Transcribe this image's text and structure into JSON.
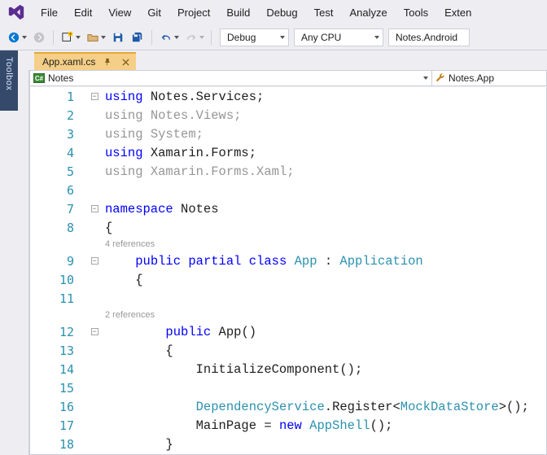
{
  "menu": [
    "File",
    "Edit",
    "View",
    "Git",
    "Project",
    "Build",
    "Debug",
    "Test",
    "Analyze",
    "Tools",
    "Exten"
  ],
  "toolbar": {
    "config": "Debug",
    "platform": "Any CPU",
    "target": "Notes.Android"
  },
  "tab": {
    "title": "App.xaml.cs"
  },
  "navbar": {
    "left_badge": "C#",
    "left": "Notes",
    "right": "Notes.App"
  },
  "toolbox_label": "Toolbox",
  "codelens": {
    "class": "4 references",
    "ctor": "2 references"
  },
  "code": {
    "l1": {
      "a": "using",
      "b": " Notes.Services;"
    },
    "l2": {
      "a": "using",
      "b": " Notes.Views;"
    },
    "l3": {
      "a": "using",
      "b": " System;"
    },
    "l4": {
      "a": "using",
      "b": " Xamarin.Forms;"
    },
    "l5": {
      "a": "using",
      "b": " Xamarin.Forms.Xaml;"
    },
    "l7": {
      "a": "namespace",
      "b": " Notes"
    },
    "l8": "{",
    "l9": {
      "a": "    ",
      "b": "public",
      "c": " ",
      "d": "partial",
      "e": " ",
      "f": "class",
      "g": " ",
      "h": "App",
      "i": " : ",
      "j": "Application"
    },
    "l10": "    {",
    "l12": {
      "a": "        ",
      "b": "public",
      "c": " App()"
    },
    "l13": "        {",
    "l14": "            InitializeComponent();",
    "l16": {
      "a": "            ",
      "b": "DependencyService",
      "c": ".Register<",
      "d": "MockDataStore",
      "e": ">();"
    },
    "l17": {
      "a": "            MainPage = ",
      "b": "new",
      "c": " ",
      "d": "AppShell",
      "e": "();"
    },
    "l18": "        }"
  },
  "lines": [
    "1",
    "2",
    "3",
    "4",
    "5",
    "6",
    "7",
    "8",
    "9",
    "10",
    "11",
    "12",
    "13",
    "14",
    "15",
    "16",
    "17",
    "18"
  ]
}
